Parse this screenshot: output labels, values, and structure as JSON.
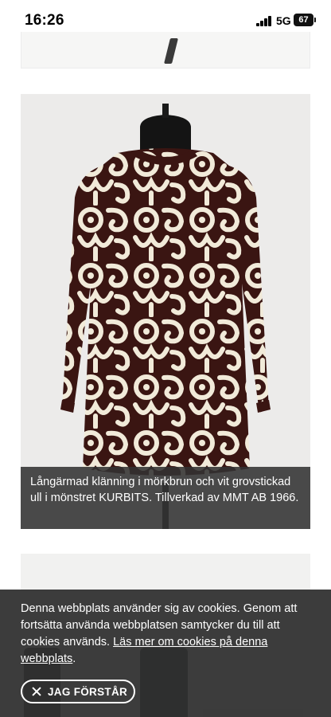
{
  "status_bar": {
    "time": "16:26",
    "network": "5G",
    "battery": "67"
  },
  "gallery": {
    "items": [
      {
        "caption": "Långärmad klänning i mörkbrun och vit grovstickad ull i mönstret KURBITS. Tillverkad av MMT AB 1966."
      }
    ]
  },
  "cookie_banner": {
    "text": "Denna webbplats använder sig av cookies. Genom att fortsätta använda webbplatsen samtycker du till att cookies används.",
    "link_label": "Läs mer om cookies på denna webbplats",
    "link_suffix": ".",
    "accept_label": "JAG FÖRSTÅR"
  },
  "colors": {
    "dress_brown": "#3a1512",
    "dress_cream": "#f1ead9",
    "overlay": "#323232"
  }
}
